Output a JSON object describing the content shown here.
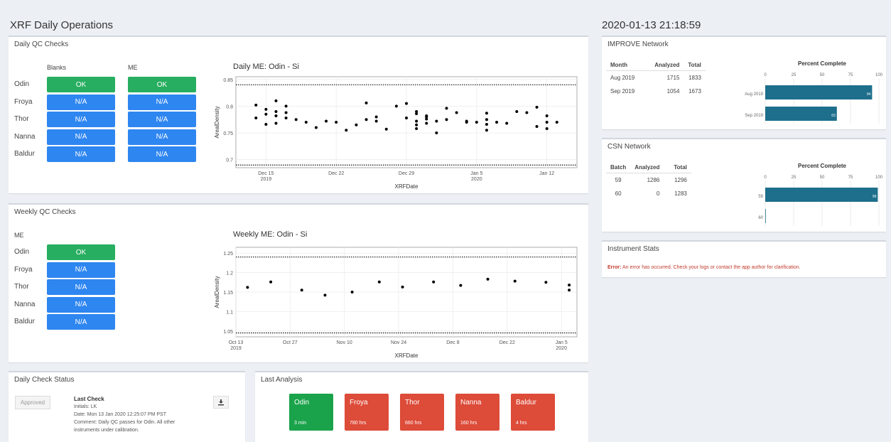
{
  "header": {
    "title": "XRF Daily Operations",
    "timestamp": "2020-01-13 21:18:59"
  },
  "daily_qc": {
    "title": "Daily QC Checks",
    "col_blanks": "Blanks",
    "col_me": "ME",
    "rows": [
      {
        "name": "Odin",
        "blanks": "OK",
        "me": "OK",
        "status": "ok"
      },
      {
        "name": "Froya",
        "blanks": "N/A",
        "me": "N/A",
        "status": "na"
      },
      {
        "name": "Thor",
        "blanks": "N/A",
        "me": "N/A",
        "status": "na"
      },
      {
        "name": "Nanna",
        "blanks": "N/A",
        "me": "N/A",
        "status": "na"
      },
      {
        "name": "Baldur",
        "blanks": "N/A",
        "me": "N/A",
        "status": "na"
      }
    ],
    "chart_title": "Daily ME: Odin - Si"
  },
  "weekly_qc": {
    "title": "Weekly QC Checks",
    "col_me": "ME",
    "rows": [
      {
        "name": "Odin",
        "me": "OK",
        "status": "ok"
      },
      {
        "name": "Froya",
        "me": "N/A",
        "status": "na"
      },
      {
        "name": "Thor",
        "me": "N/A",
        "status": "na"
      },
      {
        "name": "Nanna",
        "me": "N/A",
        "status": "na"
      },
      {
        "name": "Baldur",
        "me": "N/A",
        "status": "na"
      }
    ],
    "chart_title": "Weekly ME: Odin - Si"
  },
  "status": {
    "title": "Daily Check Status",
    "approved_label": "Approved",
    "last_check_heading": "Last Check",
    "initials": "Initials: LK",
    "date": "Date: Mon 13 Jan 2020 12:25:07 PM PST",
    "comment": "Comment: Daily QC passes for Odin. All other",
    "comment2": "instruments under calibration."
  },
  "last_analysis": {
    "title": "Last Analysis",
    "tiles": [
      {
        "name": "Odin",
        "hours": "3 min",
        "color": "#1aa34a"
      },
      {
        "name": "Froya",
        "hours": "780 hrs",
        "color": "#dd4b39"
      },
      {
        "name": "Thor",
        "hours": "660 hrs",
        "color": "#dd4b39"
      },
      {
        "name": "Nanna",
        "hours": "160 hrs",
        "color": "#dd4b39"
      },
      {
        "name": "Baldur",
        "hours": "4 hrs",
        "color": "#dd4b39"
      }
    ]
  },
  "improve": {
    "title": "IMPROVE Network",
    "table": {
      "headers": [
        "Month",
        "Analyzed",
        "Total"
      ],
      "rows": [
        [
          "Aug 2019",
          "1715",
          "1833"
        ],
        [
          "Sep 2019",
          "1054",
          "1673"
        ]
      ]
    },
    "chart_title": "Percent Complete"
  },
  "csn": {
    "title": "CSN Network",
    "table": {
      "headers": [
        "Batch",
        "Analyzed",
        "Total"
      ],
      "rows": [
        [
          "59",
          "1286",
          "1296"
        ],
        [
          "60",
          "0",
          "1283"
        ]
      ]
    },
    "chart_title": "Percent Complete"
  },
  "instrument": {
    "title": "Instrument Stats",
    "error_label": "Error:",
    "error_text": " An error has occurred. Check your logs or contact the app author for clarification."
  },
  "chart_data": [
    {
      "type": "scatter",
      "title": "Daily ME: Odin - Si",
      "xlabel": "XRFDate",
      "ylabel": "ArealDensity",
      "ylim": [
        0.685,
        0.855
      ],
      "yticks": [
        0.7,
        0.75,
        0.8,
        0.85
      ],
      "ytick_labels": [
        "0.7",
        "0.75",
        "0.8",
        "0.85"
      ],
      "xlim": [
        "2019-12-12",
        "2020-01-15"
      ],
      "xticks": [
        "2019-12-15",
        "2019-12-22",
        "2019-12-29",
        "2020-01-05",
        "2020-01-12"
      ],
      "xtick_labels": [
        [
          "Dec 15",
          "2019"
        ],
        [
          "Dec 22",
          ""
        ],
        [
          "Dec 29",
          ""
        ],
        [
          "Jan 5",
          "2020"
        ],
        [
          "Jan 12",
          ""
        ]
      ],
      "hlines": [
        0.84,
        0.69
      ],
      "points": [
        [
          "2019-12-14",
          0.802
        ],
        [
          "2019-12-14",
          0.778
        ],
        [
          "2019-12-15",
          0.794
        ],
        [
          "2019-12-15",
          0.785
        ],
        [
          "2019-12-15",
          0.766
        ],
        [
          "2019-12-16",
          0.81
        ],
        [
          "2019-12-16",
          0.79
        ],
        [
          "2019-12-16",
          0.768
        ],
        [
          "2019-12-16",
          0.782
        ],
        [
          "2019-12-17",
          0.8
        ],
        [
          "2019-12-17",
          0.788
        ],
        [
          "2019-12-17",
          0.778
        ],
        [
          "2019-12-18",
          0.775
        ],
        [
          "2019-12-19",
          0.77
        ],
        [
          "2019-12-20",
          0.76
        ],
        [
          "2019-12-21",
          0.772
        ],
        [
          "2019-12-22",
          0.77
        ],
        [
          "2019-12-23",
          0.755
        ],
        [
          "2019-12-24",
          0.765
        ],
        [
          "2019-12-25",
          0.775
        ],
        [
          "2019-12-25",
          0.806
        ],
        [
          "2019-12-26",
          0.78
        ],
        [
          "2019-12-26",
          0.772
        ],
        [
          "2019-12-27",
          0.757
        ],
        [
          "2019-12-28",
          0.8
        ],
        [
          "2019-12-29",
          0.805
        ],
        [
          "2019-12-29",
          0.778
        ],
        [
          "2019-12-30",
          0.79
        ],
        [
          "2019-12-30",
          0.786
        ],
        [
          "2019-12-30",
          0.772
        ],
        [
          "2019-12-30",
          0.765
        ],
        [
          "2019-12-31",
          0.782
        ],
        [
          "2019-12-31",
          0.78
        ],
        [
          "2019-12-31",
          0.776
        ],
        [
          "2019-12-31",
          0.768
        ],
        [
          "2019-12-30",
          0.758
        ],
        [
          "2020-01-01",
          0.772
        ],
        [
          "2020-01-01",
          0.75
        ],
        [
          "2020-01-02",
          0.796
        ],
        [
          "2020-01-02",
          0.775
        ],
        [
          "2020-01-03",
          0.788
        ],
        [
          "2020-01-04",
          0.772
        ],
        [
          "2020-01-04",
          0.77
        ],
        [
          "2020-01-05",
          0.77
        ],
        [
          "2020-01-06",
          0.787
        ],
        [
          "2020-01-06",
          0.775
        ],
        [
          "2020-01-06",
          0.766
        ],
        [
          "2020-01-06",
          0.755
        ],
        [
          "2020-01-07",
          0.77
        ],
        [
          "2020-01-08",
          0.768
        ],
        [
          "2020-01-09",
          0.79
        ],
        [
          "2020-01-10",
          0.788
        ],
        [
          "2020-01-11",
          0.798
        ],
        [
          "2020-01-11",
          0.762
        ],
        [
          "2020-01-12",
          0.782
        ],
        [
          "2020-01-12",
          0.77
        ],
        [
          "2020-01-12",
          0.758
        ],
        [
          "2020-01-13",
          0.77
        ]
      ]
    },
    {
      "type": "scatter",
      "title": "Weekly ME: Odin - Si",
      "xlabel": "XRFDate",
      "ylabel": "ArealDensity",
      "ylim": [
        1.035,
        1.265
      ],
      "yticks": [
        1.05,
        1.1,
        1.15,
        1.2,
        1.25
      ],
      "ytick_labels": [
        "1.05",
        "1.1",
        "1.15",
        "1.2",
        "1.25"
      ],
      "xlim": [
        "2019-10-13",
        "2020-01-09"
      ],
      "xticks": [
        "2019-10-13",
        "2019-10-27",
        "2019-11-10",
        "2019-11-24",
        "2019-12-08",
        "2019-12-22",
        "2020-01-05"
      ],
      "xtick_labels": [
        [
          "Oct 13",
          "2019"
        ],
        [
          "Oct 27",
          ""
        ],
        [
          "Nov 10",
          ""
        ],
        [
          "Nov 24",
          ""
        ],
        [
          "Dec 8",
          ""
        ],
        [
          "Dec 22",
          ""
        ],
        [
          "Jan 5",
          "2020"
        ]
      ],
      "hlines": [
        1.24,
        1.045
      ],
      "points": [
        [
          "2019-10-16",
          1.162
        ],
        [
          "2019-10-22",
          1.176
        ],
        [
          "2019-10-30",
          1.155
        ],
        [
          "2019-11-05",
          1.142
        ],
        [
          "2019-11-12",
          1.15
        ],
        [
          "2019-11-19",
          1.176
        ],
        [
          "2019-11-25",
          1.163
        ],
        [
          "2019-12-03",
          1.176
        ],
        [
          "2019-12-10",
          1.167
        ],
        [
          "2019-12-17",
          1.183
        ],
        [
          "2019-12-24",
          1.178
        ],
        [
          "2020-01-01",
          1.175
        ],
        [
          "2020-01-07",
          1.155
        ],
        [
          "2020-01-07",
          1.168
        ]
      ]
    },
    {
      "type": "bar",
      "orientation": "horizontal",
      "title": "Percent Complete",
      "categories": [
        "Aug 2019",
        "Sep 2019"
      ],
      "values": [
        94,
        63
      ],
      "xlim": [
        0,
        100
      ],
      "xticks": [
        0,
        25,
        50,
        75,
        100
      ],
      "color": "#1d6f8c"
    },
    {
      "type": "bar",
      "orientation": "horizontal",
      "title": "Percent Complete",
      "categories": [
        "59",
        "60"
      ],
      "values": [
        99,
        0
      ],
      "xlim": [
        0,
        100
      ],
      "xticks": [
        0,
        25,
        50,
        75,
        100
      ],
      "color": "#1d6f8c"
    }
  ]
}
